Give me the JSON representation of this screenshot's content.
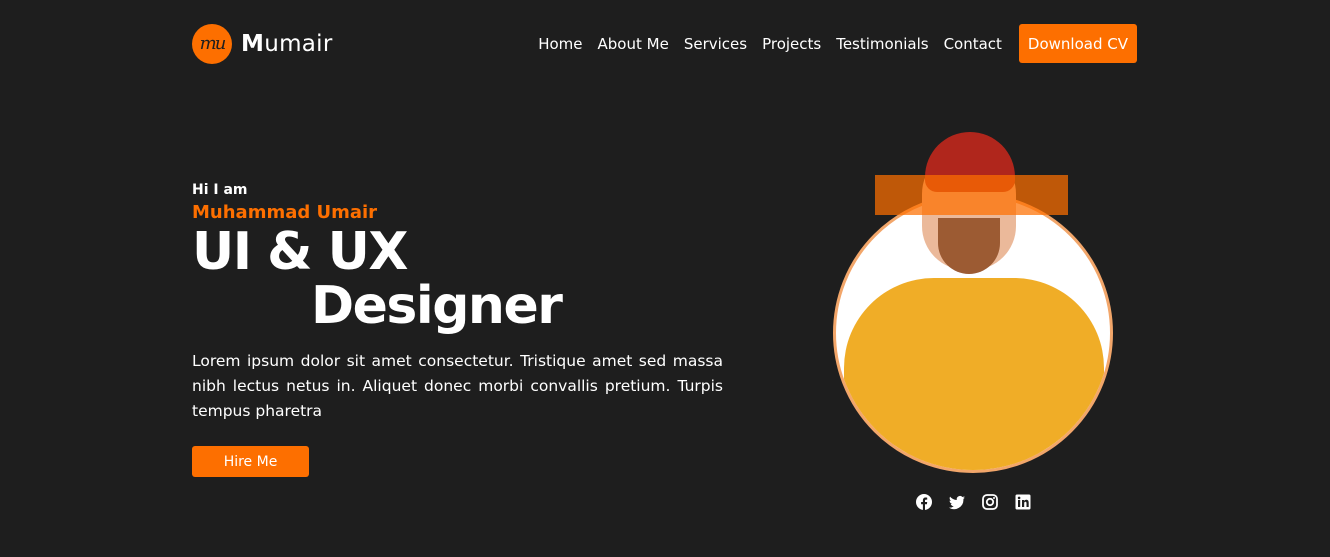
{
  "nav": {
    "logo_mark": "mu",
    "brand_initial": "M",
    "brand_rest": "umair",
    "links": [
      "Home",
      "About Me",
      "Services",
      "Projects",
      "Testimonials",
      "Contact"
    ],
    "cta_label": "Download CV"
  },
  "hero": {
    "greeting": "Hi I am",
    "name": "Muhammad Umair",
    "title_line1": "UI & UX",
    "title_line2": "Designer",
    "description": "Lorem ipsum dolor sit amet consectetur. Tristique amet sed massa nibh lectus netus in. Aliquet donec morbi convallis pretium. Turpis tempus pharetra",
    "button_label": "Hire Me"
  },
  "socials": [
    "facebook-icon",
    "twitter-icon",
    "instagram-icon",
    "linkedin-icon"
  ],
  "colors": {
    "accent": "#fd6f00",
    "background": "#1e1e1e",
    "text": "#ffffff"
  }
}
